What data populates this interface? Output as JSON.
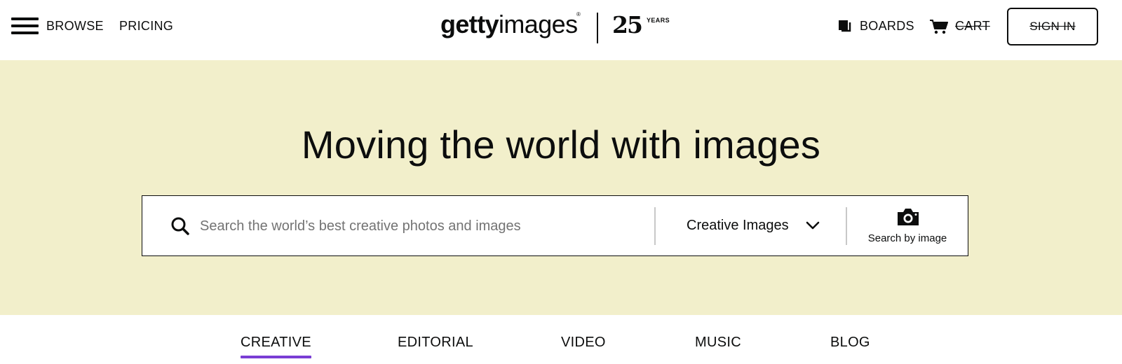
{
  "header": {
    "menu_icon": "hamburger-menu-icon",
    "browse_label": "BROWSE",
    "pricing_label": "PRICING",
    "logo_bold": "getty",
    "logo_light": "images",
    "logo_reg": "®",
    "anniversary_number": "25",
    "anniversary_label": "YEARS",
    "boards_icon": "boards-icon",
    "boards_label": "BOARDS",
    "cart_icon": "cart-icon",
    "cart_label": "CART",
    "sign_in_label": "SIGN IN"
  },
  "hero": {
    "title": "Moving the world with images",
    "background_color": "#f2efcb",
    "search": {
      "search_icon": "magnifier-icon",
      "value": "",
      "placeholder": "Search the world’s best creative photos and images",
      "type_selected": "Creative Images",
      "type_icon": "chevron-down-icon",
      "search_by_image_icon": "camera-icon",
      "search_by_image_label": "Search by image"
    }
  },
  "tabs": {
    "items": [
      {
        "label": "CREATIVE",
        "active": true
      },
      {
        "label": "EDITORIAL",
        "active": false
      },
      {
        "label": "VIDEO",
        "active": false
      },
      {
        "label": "MUSIC",
        "active": false
      },
      {
        "label": "BLOG",
        "active": false
      }
    ],
    "active_color": "#7a3dd4"
  }
}
